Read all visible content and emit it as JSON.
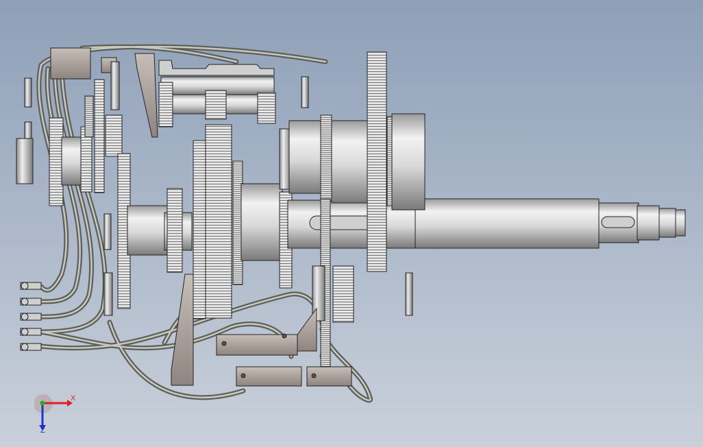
{
  "view": {
    "background_top": "#8e9fb7",
    "background_bottom": "#c9d0da",
    "model_color": "#d4d4d4",
    "edge_color": "#1a1a1a"
  },
  "triad": {
    "x_label": "X",
    "z_label": "Z",
    "x_color": "#e02020",
    "y_color": "#20b020",
    "z_color": "#2030d0"
  }
}
